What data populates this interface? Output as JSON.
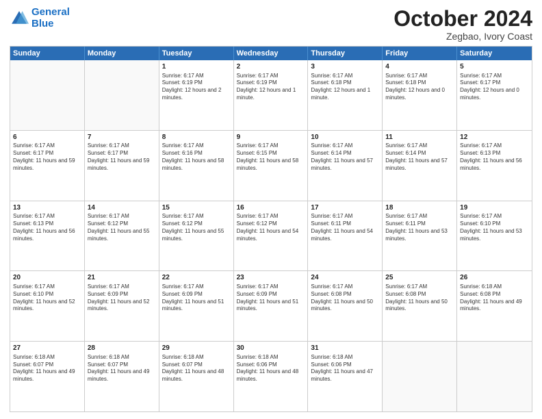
{
  "logo": {
    "line1": "General",
    "line2": "Blue"
  },
  "title": "October 2024",
  "subtitle": "Zegbao, Ivory Coast",
  "header_days": [
    "Sunday",
    "Monday",
    "Tuesday",
    "Wednesday",
    "Thursday",
    "Friday",
    "Saturday"
  ],
  "rows": [
    [
      {
        "day": "",
        "empty": true
      },
      {
        "day": "",
        "empty": true
      },
      {
        "day": "1",
        "sunrise": "Sunrise: 6:17 AM",
        "sunset": "Sunset: 6:19 PM",
        "daylight": "Daylight: 12 hours and 2 minutes."
      },
      {
        "day": "2",
        "sunrise": "Sunrise: 6:17 AM",
        "sunset": "Sunset: 6:19 PM",
        "daylight": "Daylight: 12 hours and 1 minute."
      },
      {
        "day": "3",
        "sunrise": "Sunrise: 6:17 AM",
        "sunset": "Sunset: 6:18 PM",
        "daylight": "Daylight: 12 hours and 1 minute."
      },
      {
        "day": "4",
        "sunrise": "Sunrise: 6:17 AM",
        "sunset": "Sunset: 6:18 PM",
        "daylight": "Daylight: 12 hours and 0 minutes."
      },
      {
        "day": "5",
        "sunrise": "Sunrise: 6:17 AM",
        "sunset": "Sunset: 6:17 PM",
        "daylight": "Daylight: 12 hours and 0 minutes."
      }
    ],
    [
      {
        "day": "6",
        "sunrise": "Sunrise: 6:17 AM",
        "sunset": "Sunset: 6:17 PM",
        "daylight": "Daylight: 11 hours and 59 minutes."
      },
      {
        "day": "7",
        "sunrise": "Sunrise: 6:17 AM",
        "sunset": "Sunset: 6:17 PM",
        "daylight": "Daylight: 11 hours and 59 minutes."
      },
      {
        "day": "8",
        "sunrise": "Sunrise: 6:17 AM",
        "sunset": "Sunset: 6:16 PM",
        "daylight": "Daylight: 11 hours and 58 minutes."
      },
      {
        "day": "9",
        "sunrise": "Sunrise: 6:17 AM",
        "sunset": "Sunset: 6:15 PM",
        "daylight": "Daylight: 11 hours and 58 minutes."
      },
      {
        "day": "10",
        "sunrise": "Sunrise: 6:17 AM",
        "sunset": "Sunset: 6:14 PM",
        "daylight": "Daylight: 11 hours and 57 minutes."
      },
      {
        "day": "11",
        "sunrise": "Sunrise: 6:17 AM",
        "sunset": "Sunset: 6:14 PM",
        "daylight": "Daylight: 11 hours and 57 minutes."
      },
      {
        "day": "12",
        "sunrise": "Sunrise: 6:17 AM",
        "sunset": "Sunset: 6:13 PM",
        "daylight": "Daylight: 11 hours and 56 minutes."
      }
    ],
    [
      {
        "day": "13",
        "sunrise": "Sunrise: 6:17 AM",
        "sunset": "Sunset: 6:13 PM",
        "daylight": "Daylight: 11 hours and 56 minutes."
      },
      {
        "day": "14",
        "sunrise": "Sunrise: 6:17 AM",
        "sunset": "Sunset: 6:12 PM",
        "daylight": "Daylight: 11 hours and 55 minutes."
      },
      {
        "day": "15",
        "sunrise": "Sunrise: 6:17 AM",
        "sunset": "Sunset: 6:12 PM",
        "daylight": "Daylight: 11 hours and 55 minutes."
      },
      {
        "day": "16",
        "sunrise": "Sunrise: 6:17 AM",
        "sunset": "Sunset: 6:12 PM",
        "daylight": "Daylight: 11 hours and 54 minutes."
      },
      {
        "day": "17",
        "sunrise": "Sunrise: 6:17 AM",
        "sunset": "Sunset: 6:11 PM",
        "daylight": "Daylight: 11 hours and 54 minutes."
      },
      {
        "day": "18",
        "sunrise": "Sunrise: 6:17 AM",
        "sunset": "Sunset: 6:11 PM",
        "daylight": "Daylight: 11 hours and 53 minutes."
      },
      {
        "day": "19",
        "sunrise": "Sunrise: 6:17 AM",
        "sunset": "Sunset: 6:10 PM",
        "daylight": "Daylight: 11 hours and 53 minutes."
      }
    ],
    [
      {
        "day": "20",
        "sunrise": "Sunrise: 6:17 AM",
        "sunset": "Sunset: 6:10 PM",
        "daylight": "Daylight: 11 hours and 52 minutes."
      },
      {
        "day": "21",
        "sunrise": "Sunrise: 6:17 AM",
        "sunset": "Sunset: 6:09 PM",
        "daylight": "Daylight: 11 hours and 52 minutes."
      },
      {
        "day": "22",
        "sunrise": "Sunrise: 6:17 AM",
        "sunset": "Sunset: 6:09 PM",
        "daylight": "Daylight: 11 hours and 51 minutes."
      },
      {
        "day": "23",
        "sunrise": "Sunrise: 6:17 AM",
        "sunset": "Sunset: 6:09 PM",
        "daylight": "Daylight: 11 hours and 51 minutes."
      },
      {
        "day": "24",
        "sunrise": "Sunrise: 6:17 AM",
        "sunset": "Sunset: 6:08 PM",
        "daylight": "Daylight: 11 hours and 50 minutes."
      },
      {
        "day": "25",
        "sunrise": "Sunrise: 6:17 AM",
        "sunset": "Sunset: 6:08 PM",
        "daylight": "Daylight: 11 hours and 50 minutes."
      },
      {
        "day": "26",
        "sunrise": "Sunrise: 6:18 AM",
        "sunset": "Sunset: 6:08 PM",
        "daylight": "Daylight: 11 hours and 49 minutes."
      }
    ],
    [
      {
        "day": "27",
        "sunrise": "Sunrise: 6:18 AM",
        "sunset": "Sunset: 6:07 PM",
        "daylight": "Daylight: 11 hours and 49 minutes."
      },
      {
        "day": "28",
        "sunrise": "Sunrise: 6:18 AM",
        "sunset": "Sunset: 6:07 PM",
        "daylight": "Daylight: 11 hours and 49 minutes."
      },
      {
        "day": "29",
        "sunrise": "Sunrise: 6:18 AM",
        "sunset": "Sunset: 6:07 PM",
        "daylight": "Daylight: 11 hours and 48 minutes."
      },
      {
        "day": "30",
        "sunrise": "Sunrise: 6:18 AM",
        "sunset": "Sunset: 6:06 PM",
        "daylight": "Daylight: 11 hours and 48 minutes."
      },
      {
        "day": "31",
        "sunrise": "Sunrise: 6:18 AM",
        "sunset": "Sunset: 6:06 PM",
        "daylight": "Daylight: 11 hours and 47 minutes."
      },
      {
        "day": "",
        "empty": true
      },
      {
        "day": "",
        "empty": true
      }
    ]
  ]
}
